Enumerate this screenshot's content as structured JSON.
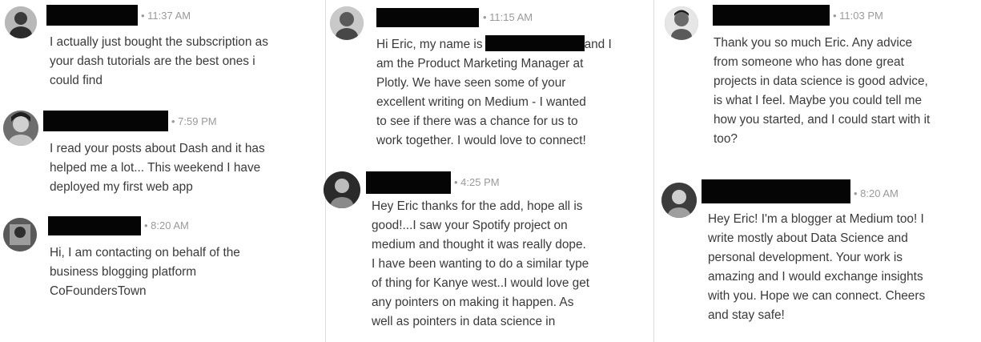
{
  "messages": [
    {
      "time": "• 11:37 AM",
      "lines": [
        "I actually just bought the subscription as",
        "your dash tutorials are the best ones i",
        "could find"
      ]
    },
    {
      "time": "• 7:59 PM",
      "lines": [
        "I read your posts about Dash and it has",
        "helped me a lot... This weekend I have",
        "deployed my first web app"
      ]
    },
    {
      "time": "• 8:20 AM",
      "lines": [
        "Hi, I am contacting on behalf of the",
        "business blogging platform",
        "CoFoundersTown"
      ]
    },
    {
      "time": "• 11:15 AM",
      "line1_prefix": "Hi Eric, my name is",
      "line1_suffix": "and I",
      "lines": [
        "am the Product Marketing Manager at",
        "Plotly. We have seen some of your",
        "excellent writing on Medium - I wanted",
        "to see if there was a chance for us to",
        "work together. I would love to connect!"
      ]
    },
    {
      "time": "• 4:25 PM",
      "lines": [
        "Hey Eric thanks for the add, hope all is",
        "good!...I saw your Spotify project on",
        "medium and thought it was really dope.",
        "I have been wanting to do a similar type",
        "of thing for Kanye west..I would love get",
        "any pointers on making it happen. As",
        "well as pointers in data science in"
      ]
    },
    {
      "time": "• 11:03 PM",
      "lines": [
        "Thank you so much Eric. Any advice",
        "from someone who has done great",
        "projects in data science is good advice,",
        "is what I feel. Maybe you could tell me",
        "how you started, and I could start with it",
        "too?"
      ]
    },
    {
      "time": "• 8:20 AM",
      "lines": [
        "Hey Eric! I'm a blogger at Medium too! I",
        "write mostly about Data Science and",
        "personal development. Your work is",
        "amazing and I would exchange insights",
        "with you. Hope we can connect. Cheers",
        "and stay safe!"
      ]
    }
  ]
}
